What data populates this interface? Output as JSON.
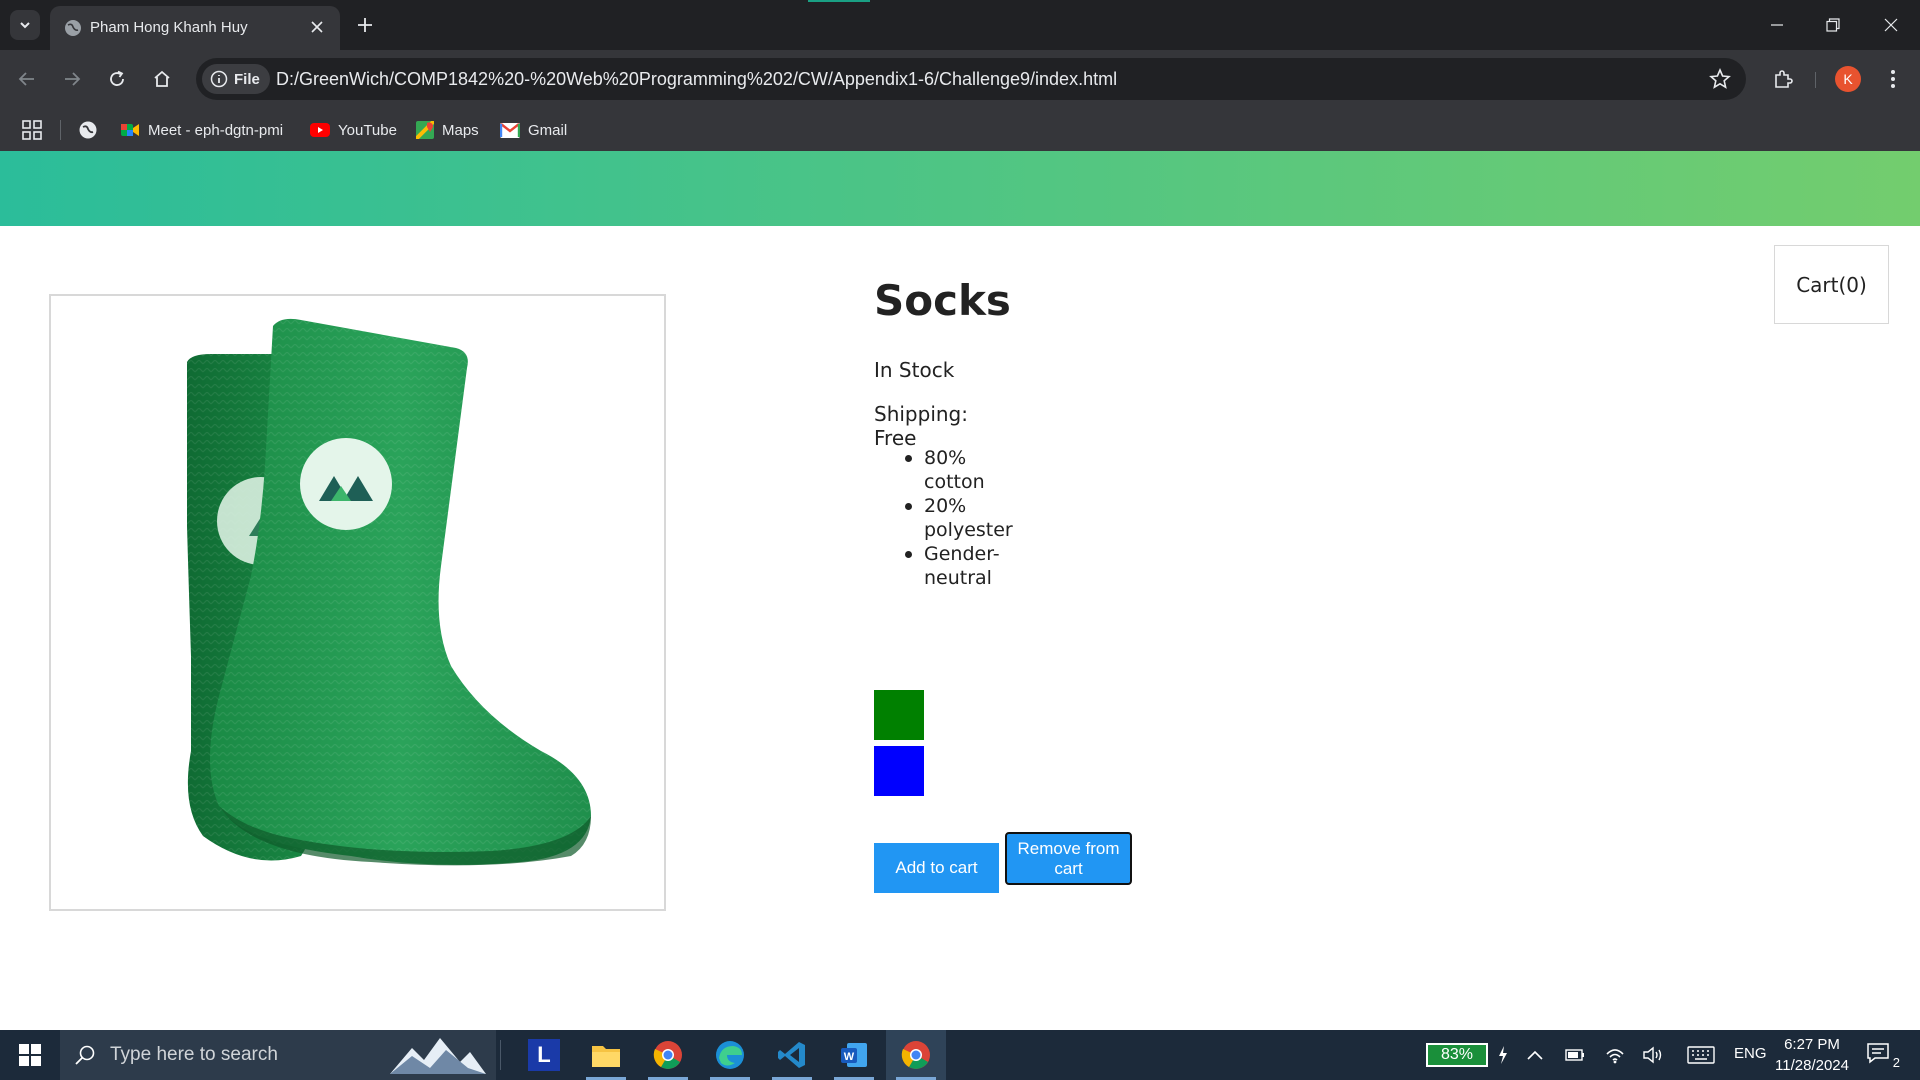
{
  "browser": {
    "tab_title": "Pham Hong Khanh Huy",
    "chip_label": "File",
    "url": "D:/GreenWich/COMP1842%20-%20Web%20Programming%202/CW/Appendix1-6/Challenge9/index.html",
    "profile_initial": "K",
    "bookmarks": [
      {
        "label": "Meet - eph-dgtn-pmi",
        "icon": "google-meet-icon"
      },
      {
        "label": "YouTube",
        "icon": "youtube-icon"
      },
      {
        "label": "Maps",
        "icon": "google-maps-icon"
      },
      {
        "label": "Gmail",
        "icon": "gmail-icon"
      }
    ]
  },
  "page": {
    "cart_label": "Cart(0)",
    "product": {
      "title": "Socks",
      "stock": "In Stock",
      "shipping": "Shipping: Free",
      "details": [
        "80% cotton",
        "20% polyester",
        "Gender-neutral"
      ],
      "variants": [
        {
          "color": "#008000"
        },
        {
          "color": "#0000ff"
        }
      ],
      "add_button": "Add to cart",
      "remove_button": "Remove from cart"
    },
    "nav_gradient": [
      "#2bbd9a",
      "#73cd6e"
    ]
  },
  "taskbar": {
    "search_placeholder": "Type here to search",
    "battery": "83%",
    "language": "ENG",
    "time": "6:27 PM",
    "date": "11/28/2024",
    "notification_count": "2"
  }
}
